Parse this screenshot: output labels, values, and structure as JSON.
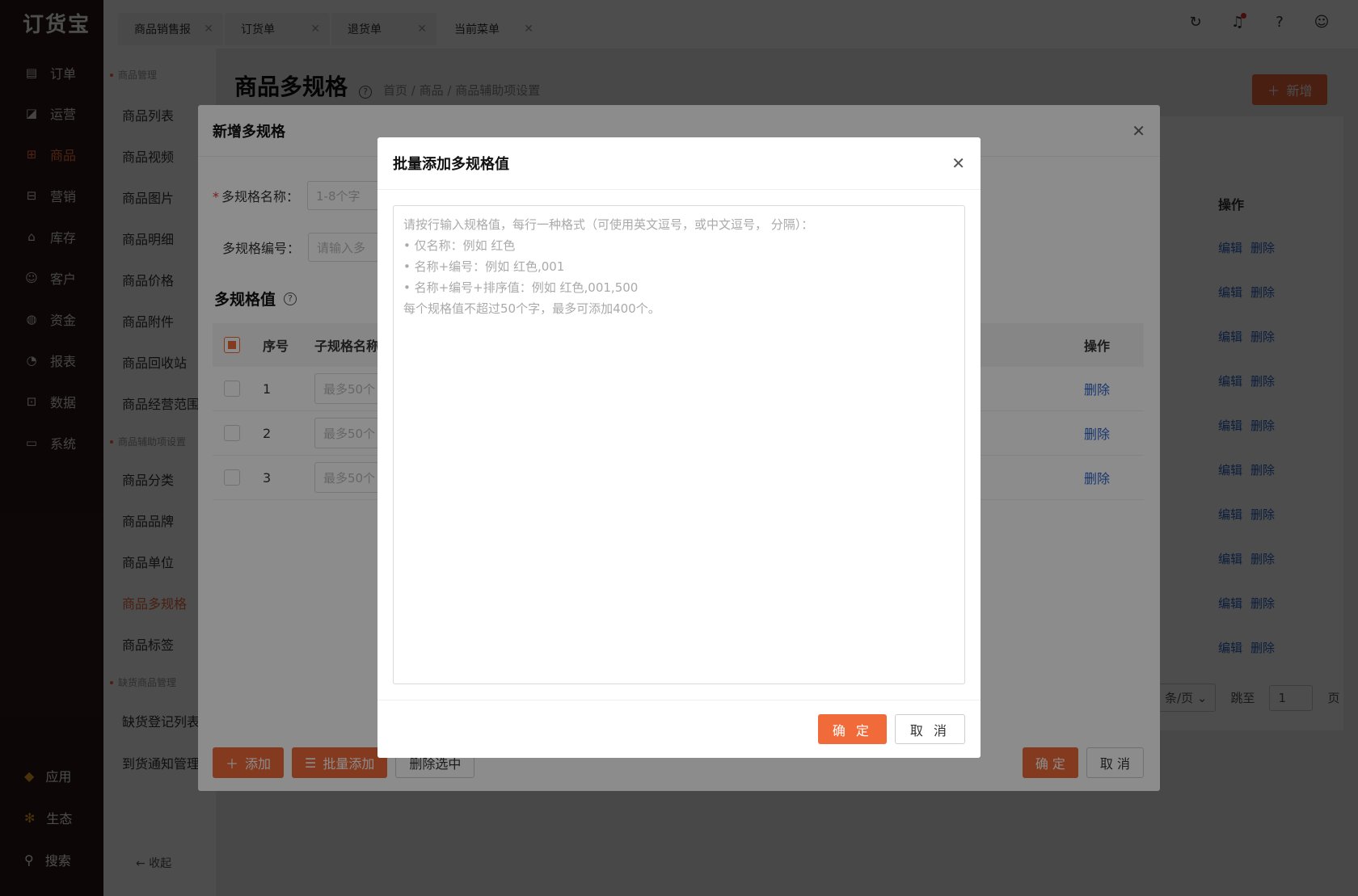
{
  "app": {
    "logo": "订货宝"
  },
  "nav": {
    "items": [
      {
        "label": "订单",
        "icon": "order-icon"
      },
      {
        "label": "运营",
        "icon": "operations-icon"
      },
      {
        "label": "商品",
        "icon": "goods-icon"
      },
      {
        "label": "营销",
        "icon": "gift-icon"
      },
      {
        "label": "库存",
        "icon": "warehouse-icon"
      },
      {
        "label": "客户",
        "icon": "user-icon"
      },
      {
        "label": "资金",
        "icon": "money-icon"
      },
      {
        "label": "报表",
        "icon": "report-icon"
      },
      {
        "label": "数据",
        "icon": "data-icon"
      },
      {
        "label": "系统",
        "icon": "monitor-icon"
      }
    ],
    "bottom": [
      {
        "label": "应用",
        "icon": "cube-icon"
      },
      {
        "label": "生态",
        "icon": "flower-icon"
      },
      {
        "label": "搜索",
        "icon": "search-icon"
      }
    ],
    "active_index": 2
  },
  "subnav": {
    "group1": "商品管理",
    "items1": [
      "商品列表",
      "商品视频",
      "商品图片",
      "商品明细",
      "商品价格",
      "商品附件",
      "商品回收站",
      "商品经营范围"
    ],
    "group2": "商品辅助项设置",
    "items2": [
      "商品分类",
      "商品品牌",
      "商品单位",
      "商品多规格",
      "商品标签"
    ],
    "group3": "缺货商品管理",
    "items3": [
      "缺货登记列表",
      "到货通知管理"
    ],
    "collapse": "← 收起"
  },
  "tabs": [
    {
      "label": "商品销售报"
    },
    {
      "label": "订货单"
    },
    {
      "label": "退货单"
    },
    {
      "label": "当前菜单"
    }
  ],
  "page": {
    "title": "商品多规格",
    "breadcrumb": "首页 / 商品 / 商品辅助项设置",
    "new_button": "新增",
    "op_header": "操作",
    "row_edit": "编辑",
    "row_delete": "删除",
    "pager_size": "条/页",
    "pager_jump": "跳至",
    "pager_page_value": "1",
    "pager_page_unit": "页"
  },
  "dialog1": {
    "title": "新增多规格",
    "name_label": "多规格名称：",
    "name_placeholder": "1-8个字",
    "code_label": "多规格编号：",
    "code_placeholder": "请输入多",
    "section_title": "多规格值",
    "columns": {
      "no": "序号",
      "name": "子规格名称",
      "op": "操作"
    },
    "rows": [
      {
        "no": "1",
        "placeholder": "最多50个",
        "op": "删除"
      },
      {
        "no": "2",
        "placeholder": "最多50个",
        "op": "删除"
      },
      {
        "no": "3",
        "placeholder": "最多50个",
        "op": "删除"
      }
    ],
    "add_button": "添加",
    "batch_button": "批量添加",
    "delete_selected": "删除选中",
    "ok": "确 定",
    "cancel": "取 消"
  },
  "dialog2": {
    "title": "批量添加多规格值",
    "placeholder_lines": [
      "请按行输入规格值，每行一种格式（可使用英文逗号，或中文逗号， 分隔）：",
      "• 仅名称：例如 红色",
      "• 名称+编号：例如 红色,001",
      "• 名称+编号+排序值：例如 红色,001,500",
      "每个规格值不超过50个字，最多可添加400个。"
    ],
    "ok": "确 定",
    "cancel": "取 消"
  },
  "colors": {
    "accent": "#f06a3a",
    "link": "#2a64c9",
    "nav_bg": "#2a1717"
  }
}
